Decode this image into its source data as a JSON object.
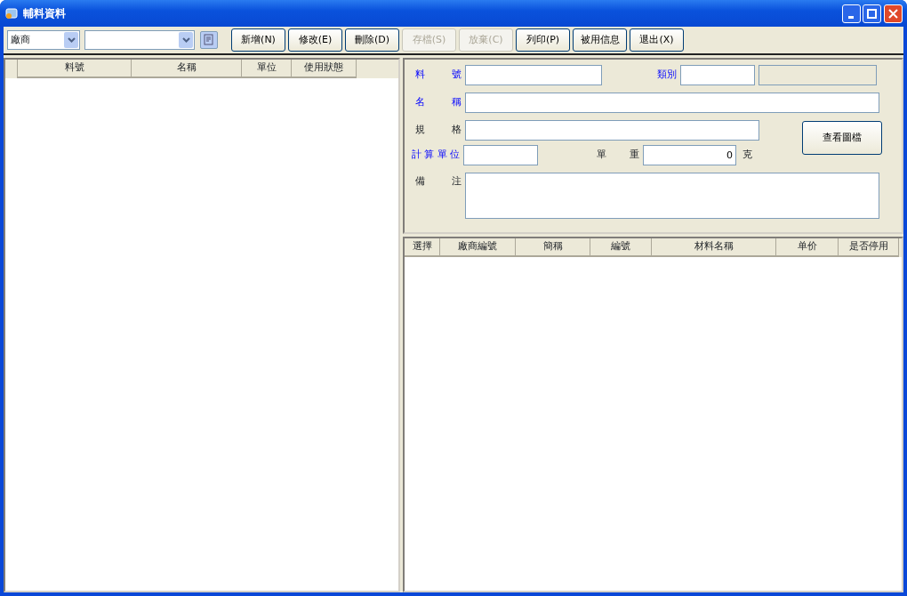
{
  "window": {
    "title": "輔料資料"
  },
  "toolbar": {
    "vendor_select": {
      "value": "廠商"
    },
    "buttons": [
      {
        "label": "新增(N)",
        "disabled": false
      },
      {
        "label": "修改(E)",
        "disabled": false
      },
      {
        "label": "刪除(D)",
        "disabled": false
      },
      {
        "label": "存檔(S)",
        "disabled": true
      },
      {
        "label": "放棄(C)",
        "disabled": true
      },
      {
        "label": "列印(P)",
        "disabled": false
      },
      {
        "label": "被用信息",
        "disabled": false
      },
      {
        "label": "退出(X)",
        "disabled": false
      }
    ]
  },
  "item_table": {
    "columns": [
      "料號",
      "名稱",
      "單位",
      "使用狀態"
    ]
  },
  "form": {
    "code": {
      "label": "料 號",
      "required": true
    },
    "category": {
      "label": "類別",
      "required": true
    },
    "name": {
      "label": "名 稱",
      "required": true
    },
    "spec": {
      "label": "規 格",
      "required": false
    },
    "unit": {
      "label": "計算單位",
      "required": true
    },
    "weight": {
      "label": "單 重",
      "required": false,
      "value": "0",
      "suffix": "克"
    },
    "note": {
      "label": "備 注",
      "required": false
    },
    "view_image_button": "查看圖檔"
  },
  "supplier_table": {
    "columns": [
      "選擇",
      "廠商編號",
      "簡稱",
      "編號",
      "材料名稱",
      "单价",
      "是否停用"
    ]
  }
}
